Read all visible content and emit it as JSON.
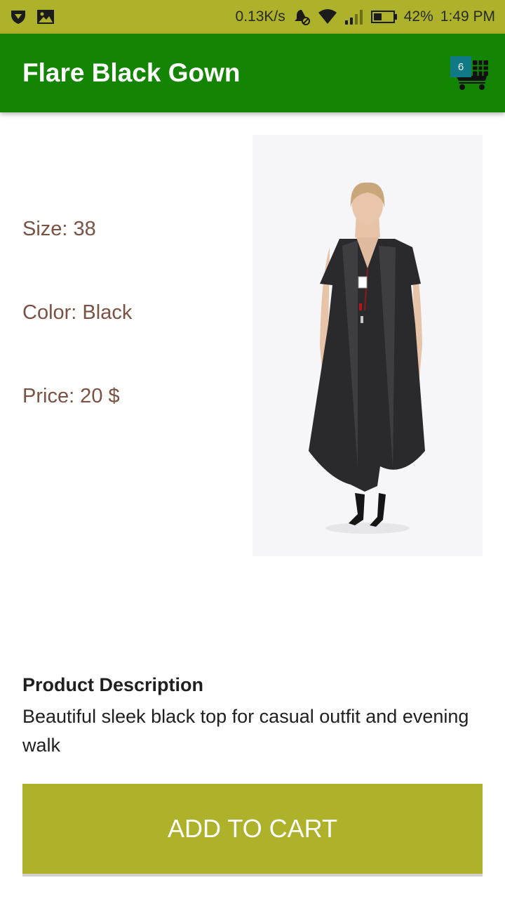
{
  "status_bar": {
    "network_speed": "0.13K/s",
    "battery_percent": "42%",
    "battery_level": 0.42,
    "time": "1:49 PM",
    "icons": [
      "shield-icon",
      "gallery-icon",
      "notification-muted-icon",
      "wifi-icon",
      "cellular-signal-icon",
      "battery-icon"
    ]
  },
  "app_bar": {
    "title": "Flare Black Gown",
    "cart_count": "6",
    "cart_icon": "cart-icon"
  },
  "product": {
    "size": "Size: 38",
    "color": "Color: Black",
    "price": "Price: 20 $",
    "image_subject": "model-in-black-gown"
  },
  "description": {
    "title": "Product Description",
    "text": "Beautiful sleek black top for casual outfit and evening walk"
  },
  "actions": {
    "add_to_cart": "ADD TO CART"
  },
  "colors": {
    "status_bar": "#aeb22a",
    "app_bar": "#138503",
    "attribute_text": "#7a5244",
    "button": "#aeb22a",
    "badge": "#0f7a86"
  }
}
